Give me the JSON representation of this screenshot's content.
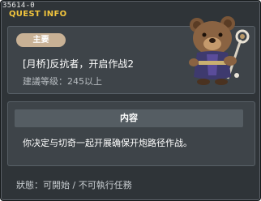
{
  "header": {
    "quest_id": "35614-0",
    "title": "QUEST INFO"
  },
  "quest": {
    "badge": "主要",
    "name": "[月桥]反抗者，开启作战2",
    "requirement": "建議等级：245以上"
  },
  "content": {
    "heading": "内容",
    "text": "你决定与切奇一起开展确保开炮路径作战。"
  },
  "status": {
    "text": "狀態：可開始 / 不可執行任務"
  },
  "npc": {
    "icon": "bear-npc-icon"
  },
  "colors": {
    "window_bg": "#2f3438",
    "panel_bg": "#3e4449",
    "title_color": "#f2c53d",
    "badge_bg": "#c8b195"
  }
}
